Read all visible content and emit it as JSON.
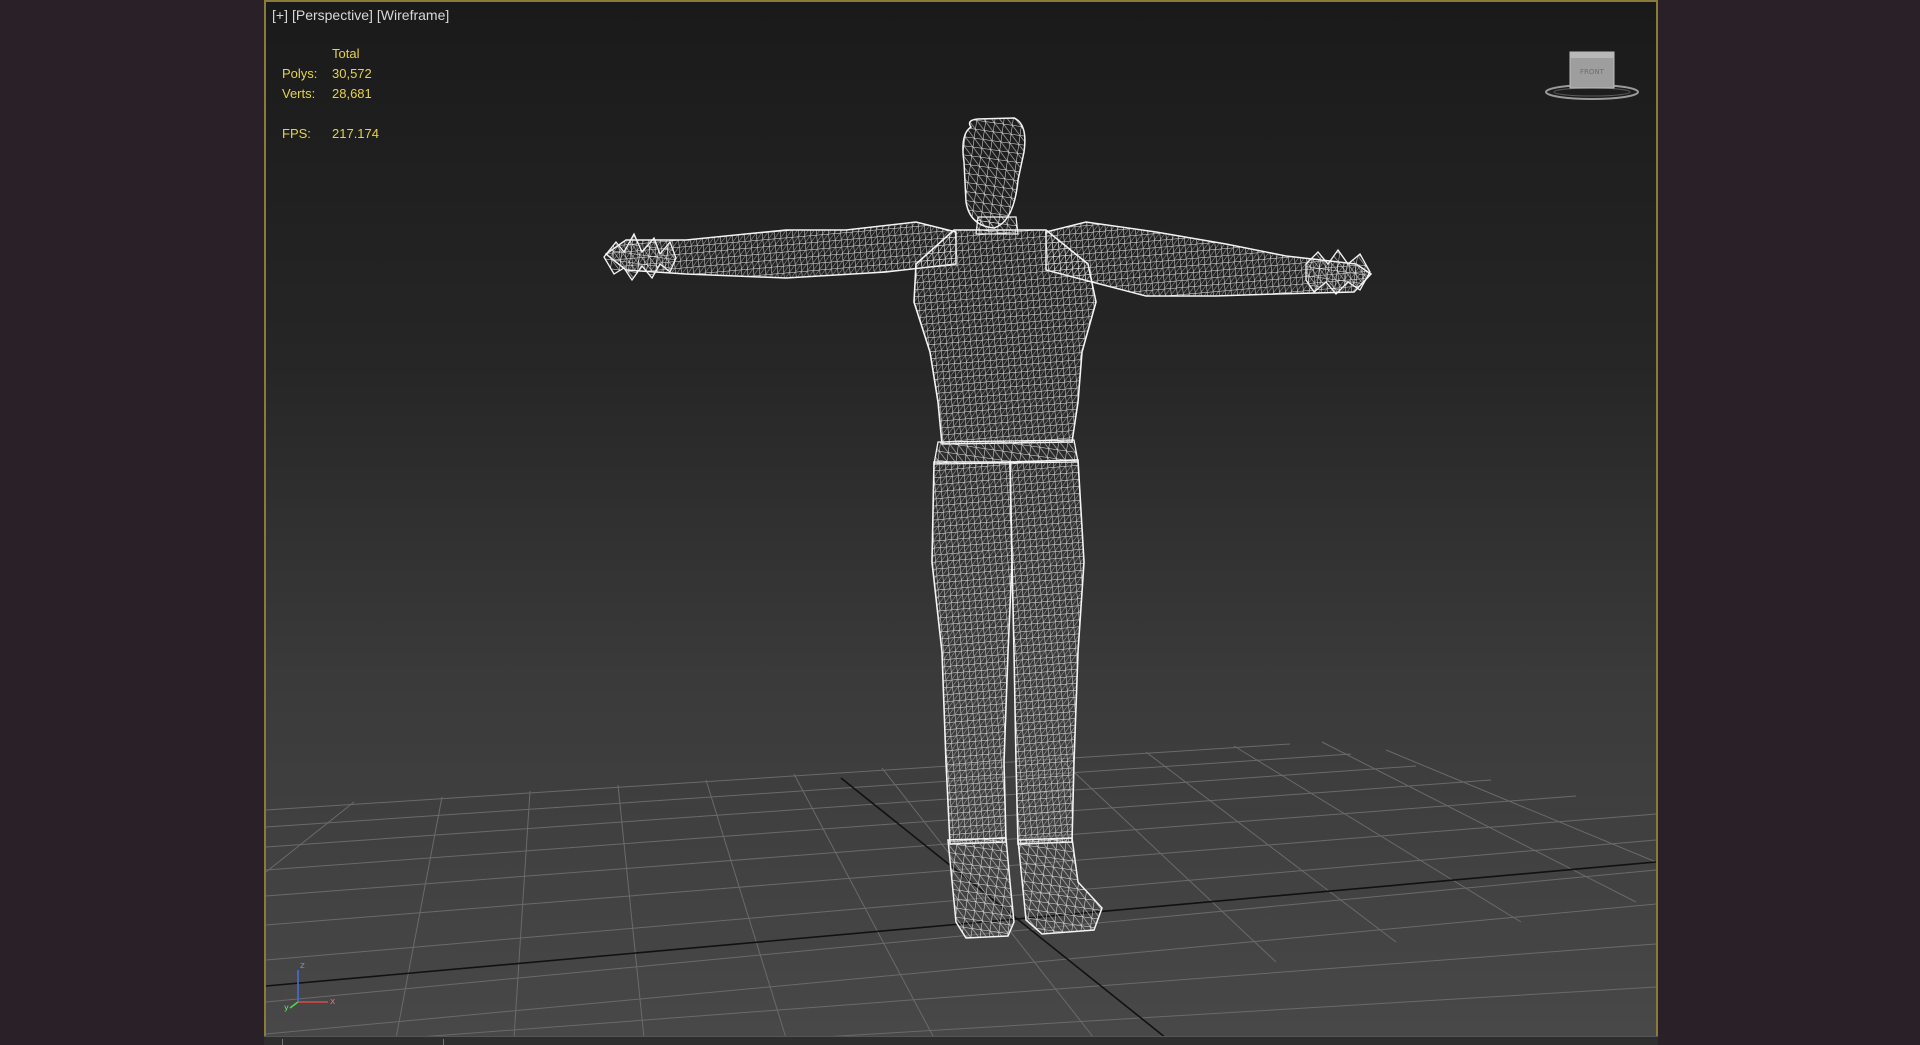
{
  "viewport": {
    "label_plus": "[+]",
    "label_view": "[Perspective]",
    "label_mode": "[Wireframe]"
  },
  "stats": {
    "total_label": "Total",
    "polys_label": "Polys:",
    "polys_value": "30,572",
    "verts_label": "Verts:",
    "verts_value": "28,681",
    "fps_label": "FPS:",
    "fps_value": "217.174"
  },
  "viewcube": {
    "face_label": "FRONT"
  },
  "axis_gizmo": {
    "z_label": "z",
    "x_label": "x",
    "y_label": "y"
  },
  "colors": {
    "stats_text": "#e6d24a",
    "viewport_border": "#8a7a3c",
    "wireframe": "#e6e6e6",
    "grid": "#6a6a6a",
    "grid_axis": "#111111"
  },
  "icons": {
    "viewcube": "viewcube-icon",
    "axis_tripod": "axis-tripod-icon"
  }
}
